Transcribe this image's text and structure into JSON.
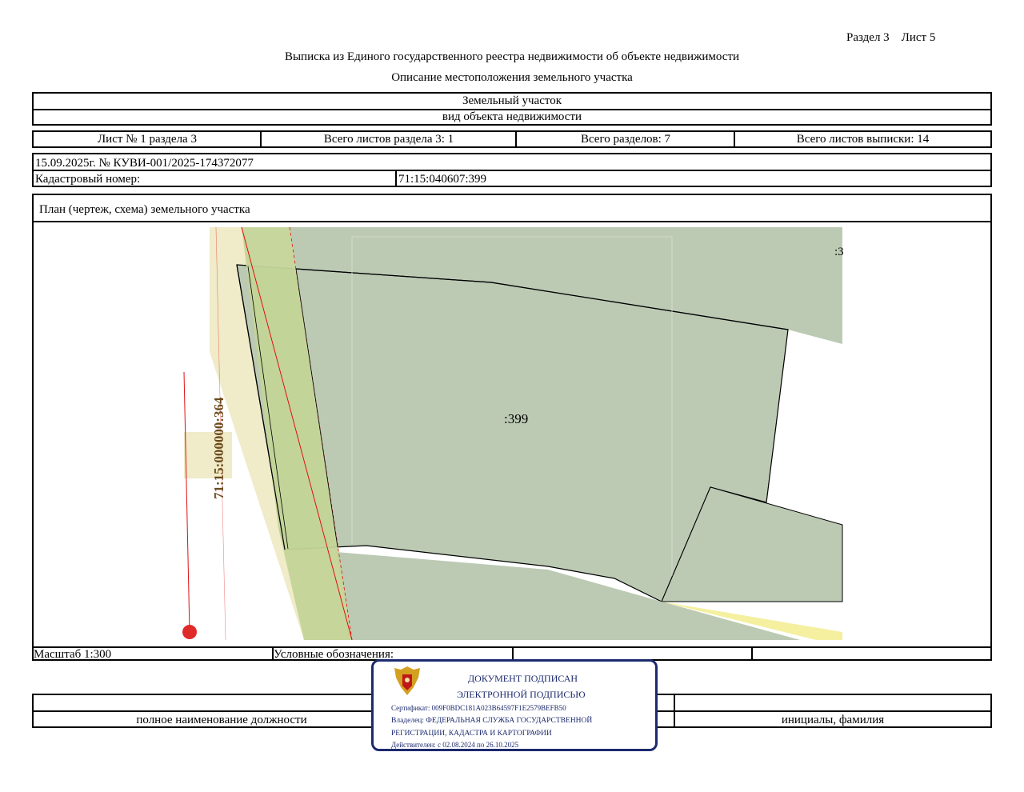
{
  "header": {
    "section_sheet": "Раздел 3    Лист 5",
    "title": "Выписка из Единого государственного реестра недвижимости об объекте недвижимости",
    "subtitle": "Описание местоположения земельного участка"
  },
  "object": {
    "type": "Земельный участок",
    "type_caption": "вид объекта недвижимости"
  },
  "sheets": {
    "sheet_of_section": "Лист № 1 раздела 3",
    "total_sheets_section": "Всего листов раздела 3: 1",
    "total_sections": "Всего разделов: 7",
    "total_sheets_extract": "Всего листов выписки: 14"
  },
  "doc": {
    "date_number": "15.09.2025г. № КУВИ-001/2025-174372077",
    "cadastral_label": "Кадастровый номер:",
    "cadastral_value": "71:15:040607:399"
  },
  "plan": {
    "title": "План (чертеж, схема) земельного участка",
    "parcel_label": ":399",
    "neighbor_label": "71:15:000000:364",
    "corner_label": ":3",
    "colors": {
      "parcel_fill": "#bccab4",
      "road_fill": "#f0ebc8",
      "strip_fill": "#c3d498",
      "boundary": "#ff0000"
    }
  },
  "legend": {
    "scale": "Масштаб 1:300",
    "legend_label": "Условные обозначения:"
  },
  "signature": {
    "position_caption": "полное наименование должности",
    "name_caption": "инициалы, фамилия"
  },
  "stamp": {
    "line1": "ДОКУМЕНТ ПОДПИСАН",
    "line2": "ЭЛЕКТРОННОЙ ПОДПИСЬЮ",
    "certificate": "Сертификат: 009F0BDC181A023B64597F1E2579BEFB50",
    "owner1": "Владелец: ФЕДЕРАЛЬНАЯ СЛУЖБА ГОСУДАРСТВЕННОЙ",
    "owner2": "РЕГИСТРАЦИИ, КАДАСТРА И КАРТОГРАФИИ",
    "validity": "Действителен: с 02.08.2024 по 26.10.2025",
    "emblem": "coat-of-arms-emblem"
  }
}
